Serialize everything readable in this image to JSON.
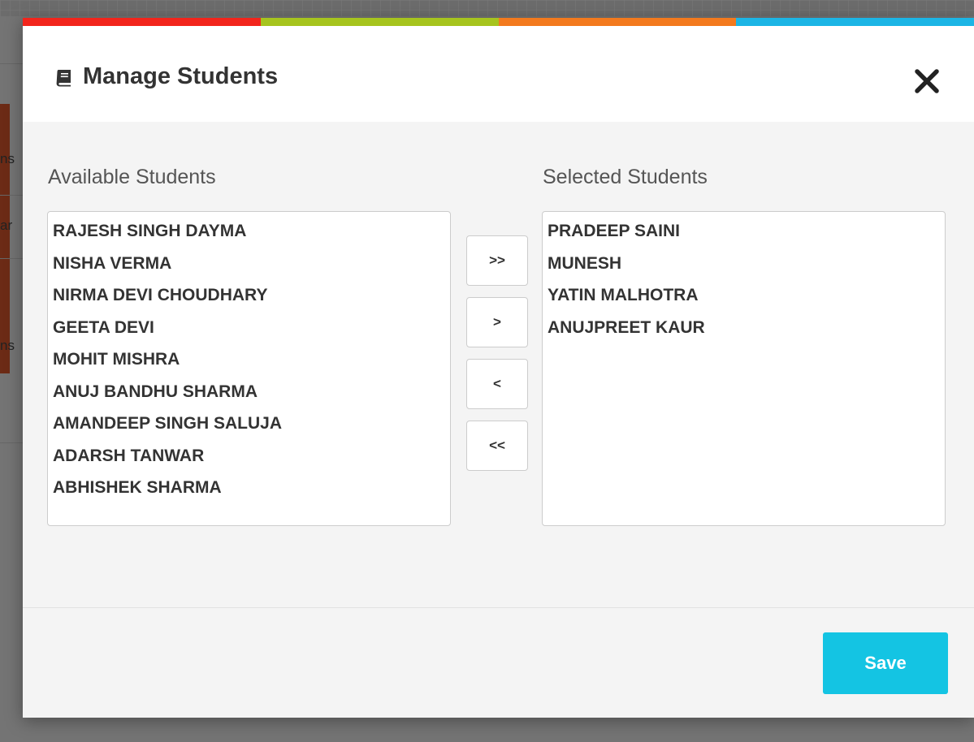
{
  "background": {
    "fragments": [
      "ns",
      "ar",
      "ns"
    ]
  },
  "modal": {
    "title": "Manage Students",
    "title_icon": "book-icon",
    "close_icon": "close-icon",
    "strip_colors": [
      "#f2251c",
      "#a6c41e",
      "#f37a1e",
      "#1cb5e5"
    ]
  },
  "available": {
    "label": "Available Students",
    "items": [
      "RAJESH SINGH DAYMA",
      "NISHA VERMA",
      "NIRMA DEVI CHOUDHARY",
      "GEETA DEVI",
      "MOHIT MISHRA",
      "ANUJ BANDHU SHARMA",
      "AMANDEEP SINGH SALUJA",
      "ADARSH TANWAR",
      "ABHISHEK SHARMA"
    ]
  },
  "selected": {
    "label": "Selected Students",
    "items": [
      "PRADEEP SAINI",
      "MUNESH",
      "YATIN MALHOTRA",
      "ANUJPREET KAUR"
    ]
  },
  "controls": {
    "move_all_right": ">>",
    "move_right": ">",
    "move_left": "<",
    "move_all_left": "<<"
  },
  "footer": {
    "save_label": "Save",
    "save_color": "#14c4e3"
  }
}
